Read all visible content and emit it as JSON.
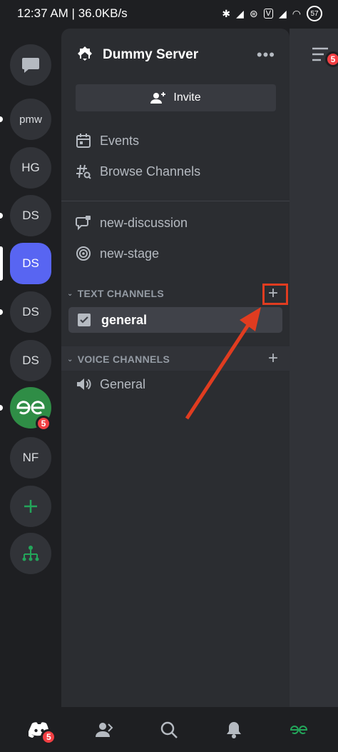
{
  "status_bar": {
    "time_speed": "12:37 AM | 36.0KB/s",
    "battery": "57",
    "volte": "V"
  },
  "servers": [
    {
      "label": "",
      "icon": "chat-bubble-icon"
    },
    {
      "label": "pmw",
      "unread": true
    },
    {
      "label": "HG",
      "unread": false
    },
    {
      "label": "DS",
      "unread": true
    },
    {
      "label": "DS",
      "selected": true
    },
    {
      "label": "DS",
      "unread": true
    },
    {
      "label": "DS",
      "unread": false
    },
    {
      "label": "GfG",
      "badge": "5",
      "unread": true
    },
    {
      "label": "NF",
      "unread": false
    }
  ],
  "server_panel": {
    "name": "Dummy Server",
    "invite_label": "Invite",
    "events_label": "Events",
    "browse_label": "Browse Channels",
    "channels": [
      "new-discussion",
      "new-stage"
    ]
  },
  "text_category": {
    "label": "TEXT CHANNELS",
    "channels": [
      "general"
    ]
  },
  "voice_category": {
    "label": "VOICE CHANNELS",
    "channels": [
      "General"
    ]
  },
  "right_pane": {
    "badge": "5"
  },
  "bottom_nav": {
    "home_badge": "5"
  },
  "colors": {
    "accent": "#5865f2",
    "green": "#23a55a",
    "badge": "#f23f43",
    "annotation": "#e03c20"
  }
}
